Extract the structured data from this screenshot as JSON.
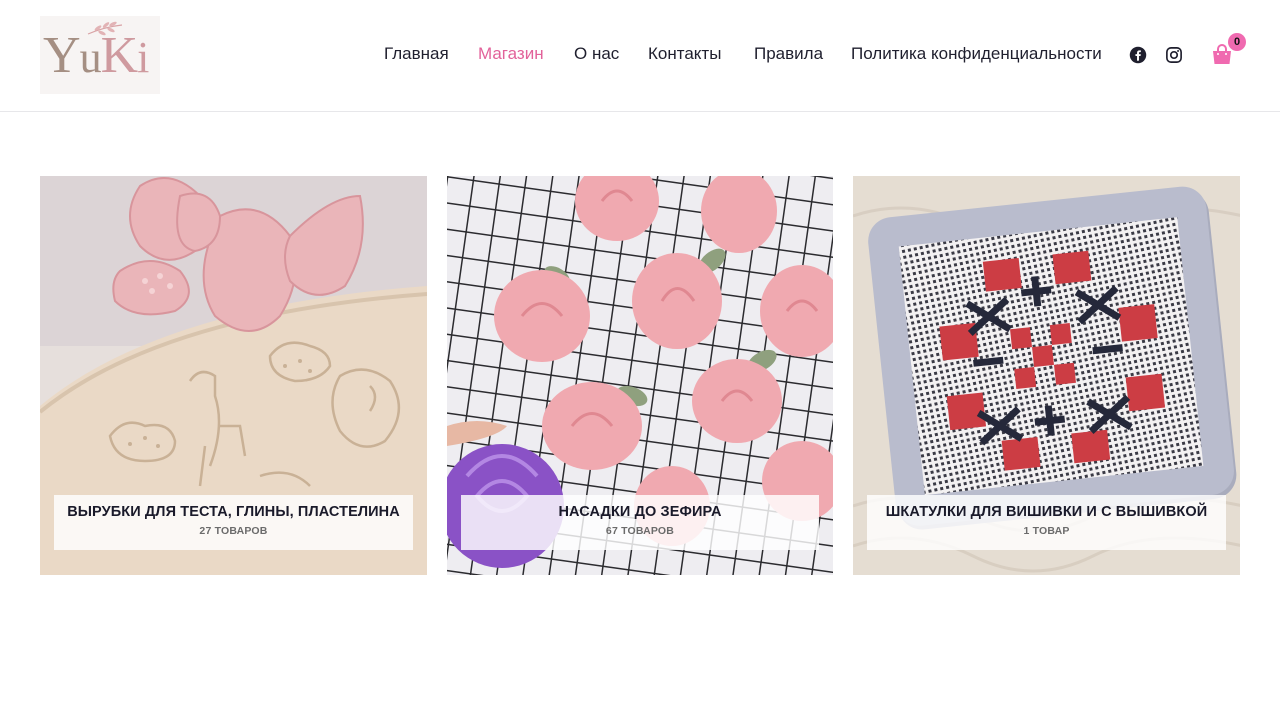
{
  "logo": {
    "text_y": "Y",
    "text_u": "u",
    "text_k": "K",
    "text_i": "i"
  },
  "nav": {
    "items": [
      {
        "label": "Главная"
      },
      {
        "label": "Магазин"
      },
      {
        "label": "О нас"
      },
      {
        "label": "Контакты"
      },
      {
        "label": "Правила"
      },
      {
        "label": "Политика конфиденциальности"
      }
    ],
    "active_index": 1
  },
  "icons": {
    "facebook": "facebook-icon",
    "instagram": "instagram-icon",
    "cart": "shopping-bag-icon"
  },
  "cart": {
    "count": "0"
  },
  "colors": {
    "accent": "#e2629a",
    "badge": "#f06ab0",
    "text": "#1f1f2e"
  },
  "categories": [
    {
      "title": "ВЫРУБКИ ДЛЯ ТЕСТА, ГЛИНЫ, ПЛАСТЕЛИНА",
      "count": "27 ТОВАРОВ"
    },
    {
      "title": "НАСАДКИ ДО ЗЕФИРА",
      "count": "67 ТОВАРОВ"
    },
    {
      "title": "ШКАТУЛКИ ДЛЯ ВИШИВКИ И С ВЫШИВКОЙ",
      "count": "1 ТОВАР"
    }
  ]
}
